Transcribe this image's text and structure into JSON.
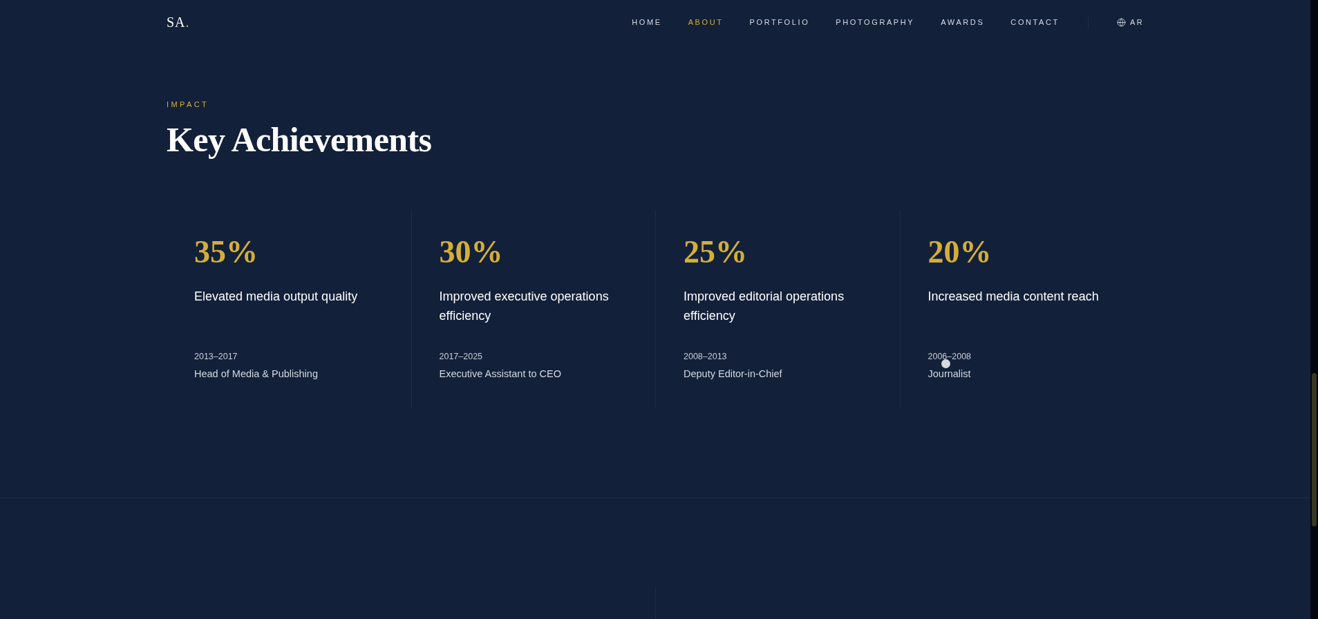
{
  "header": {
    "logo": {
      "initials": "SA",
      "dot": "."
    },
    "nav": [
      {
        "label": "HOME",
        "selected": false
      },
      {
        "label": "ABOUT",
        "selected": true
      },
      {
        "label": "PORTFOLIO",
        "selected": false
      },
      {
        "label": "PHOTOGRAPHY",
        "selected": false
      },
      {
        "label": "AWARDS",
        "selected": false
      },
      {
        "label": "CONTACT",
        "selected": false
      }
    ],
    "language": {
      "label": "AR"
    }
  },
  "section": {
    "eyebrow": "IMPACT",
    "title": "Key Achievements",
    "achievements": [
      {
        "value": "35%",
        "description": "Elevated media output quality",
        "period": "2013–2017",
        "role": "Head of Media & Publishing"
      },
      {
        "value": "30%",
        "description": "Improved executive operations efficiency",
        "period": "2017–2025",
        "role": "Executive Assistant to CEO"
      },
      {
        "value": "25%",
        "description": "Improved editorial operations efficiency",
        "period": "2008–2013",
        "role": "Deputy Editor-in-Chief"
      },
      {
        "value": "20%",
        "description": "Increased media content reach",
        "period": "2006–2008",
        "role": "Journalist"
      }
    ]
  }
}
